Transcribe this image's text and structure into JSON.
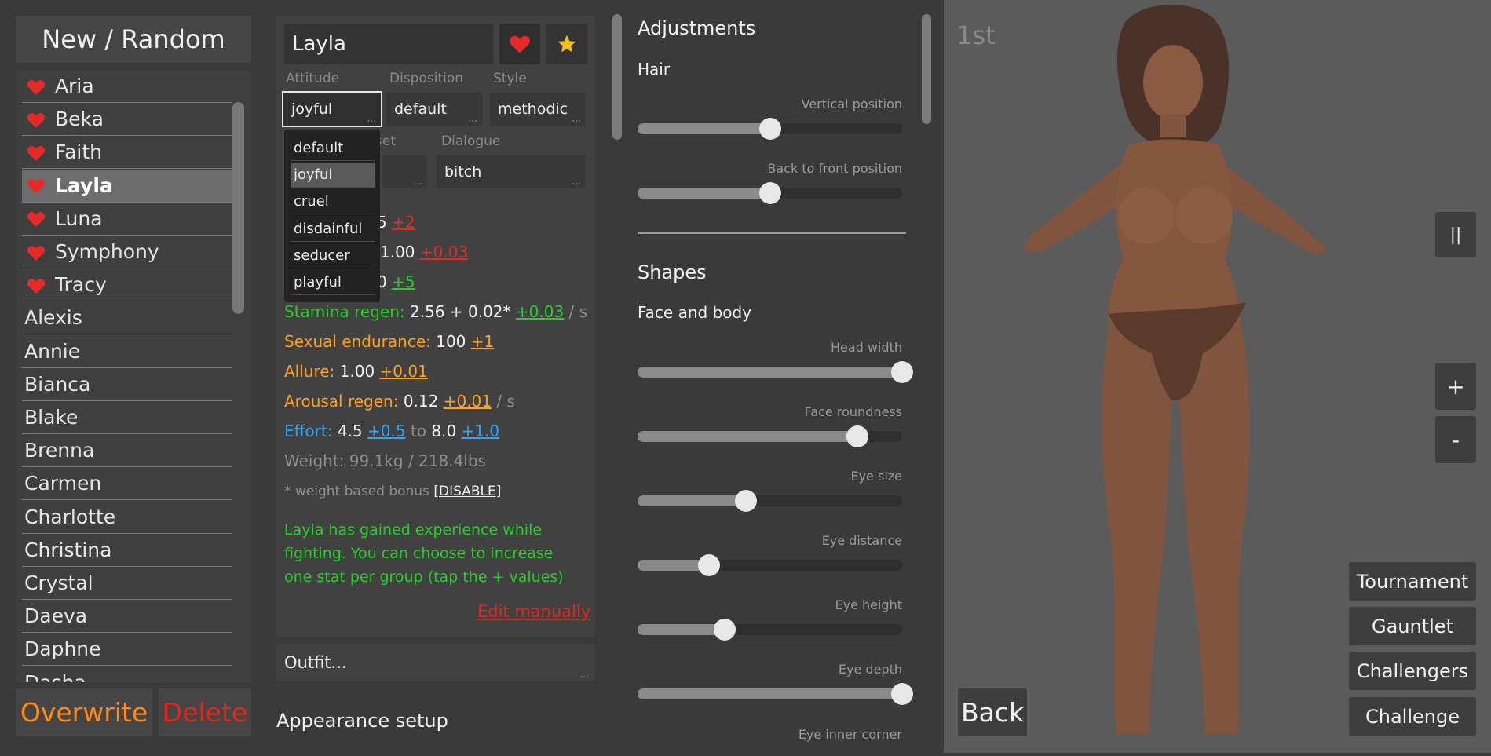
{
  "left": {
    "new_random_label": "New / Random",
    "roster": [
      {
        "name": "Aria",
        "favorite": true
      },
      {
        "name": "Beka",
        "favorite": true
      },
      {
        "name": "Faith",
        "favorite": true
      },
      {
        "name": "Layla",
        "favorite": true,
        "selected": true
      },
      {
        "name": "Luna",
        "favorite": true
      },
      {
        "name": "Symphony",
        "favorite": true
      },
      {
        "name": "Tracy",
        "favorite": true
      },
      {
        "name": "Alexis",
        "favorite": false
      },
      {
        "name": "Annie",
        "favorite": false
      },
      {
        "name": "Bianca",
        "favorite": false
      },
      {
        "name": "Blake",
        "favorite": false
      },
      {
        "name": "Brenna",
        "favorite": false
      },
      {
        "name": "Carmen",
        "favorite": false
      },
      {
        "name": "Charlotte",
        "favorite": false
      },
      {
        "name": "Christina",
        "favorite": false
      },
      {
        "name": "Crystal",
        "favorite": false
      },
      {
        "name": "Daeva",
        "favorite": false
      },
      {
        "name": "Daphne",
        "favorite": false
      },
      {
        "name": "Dasha",
        "favorite": false
      }
    ],
    "overwrite_label": "Overwrite",
    "delete_label": "Delete"
  },
  "character": {
    "name": "Layla",
    "icons": {
      "favorite": "heart-icon",
      "star": "star-icon"
    },
    "attitude_label": "Attitude",
    "attitude_value": "joyful",
    "disposition_label": "Disposition",
    "disposition_value": "default",
    "style_label": "Style",
    "style_value": "methodic",
    "preset_label_fragment": "set",
    "dialogue_label": "Dialogue",
    "dialogue_value": "bitch",
    "field_ellipsis": "...",
    "attitude_options": [
      "default",
      "joyful",
      "cruel",
      "disdainful",
      "seducer",
      "playful"
    ],
    "attitude_selected": "joyful"
  },
  "stats": {
    "row1": {
      "value": "5",
      "bonus": "+2"
    },
    "row2": {
      "value": "1.00",
      "bonus": "+0.03"
    },
    "row3": {
      "value": "0",
      "bonus": "+5"
    },
    "stamina_regen": {
      "label": "Stamina regen:",
      "value": "2.56 + 0.02*",
      "bonus": "+0.03",
      "unit": "/ s"
    },
    "sexual_endurance": {
      "label": "Sexual endurance:",
      "value": "100",
      "bonus": "+1"
    },
    "allure": {
      "label": "Allure:",
      "value": "1.00",
      "bonus": "+0.01"
    },
    "arousal_regen": {
      "label": "Arousal regen:",
      "value": "0.12",
      "bonus": "+0.01",
      "unit": "/ s"
    },
    "effort": {
      "label": "Effort:",
      "min": "4.5",
      "min_bonus": "+0.5",
      "to": "to",
      "max": "8.0",
      "max_bonus": "+1.0"
    },
    "weight": "Weight: 99.1kg / 218.4lbs",
    "weight_note": "* weight based bonus",
    "weight_note_toggle": "[DISABLE]",
    "experience_message_line1": "Layla has gained experience while",
    "experience_message_line2": "fighting. You can choose to increase",
    "experience_message_line3": "one stat per group (tap the + values)",
    "edit_manually": "Edit manually",
    "colors": {
      "green": "#27d027",
      "orange": "#ffa11c",
      "blue": "#27a6ff",
      "red": "#e22a20"
    }
  },
  "outfit_label": "Outfit...",
  "appearance_setup_label": "Appearance setup",
  "adjustments": {
    "title": "Adjustments",
    "hair_title": "Hair",
    "hair_sliders": [
      {
        "label": "Vertical position",
        "value": 0.5
      },
      {
        "label": "Back to front position",
        "value": 0.5
      }
    ],
    "shapes_title": "Shapes",
    "face_body_title": "Face and body",
    "shape_sliders": [
      {
        "label": "Head width",
        "value": 1.0
      },
      {
        "label": "Face roundness",
        "value": 0.83
      },
      {
        "label": "Eye size",
        "value": 0.41
      },
      {
        "label": "Eye distance",
        "value": 0.27
      },
      {
        "label": "Eye height",
        "value": 0.33
      },
      {
        "label": "Eye depth",
        "value": 1.0
      }
    ],
    "cutoff_label": "Eye inner corner"
  },
  "viewport": {
    "rank": "1st",
    "back_label": "Back",
    "pause_label": "||",
    "zoom_in_label": "+",
    "zoom_out_label": "-",
    "tournament_label": "Tournament",
    "gauntlet_label": "Gauntlet",
    "challengers_label": "Challengers",
    "challenge_label": "Challenge"
  }
}
